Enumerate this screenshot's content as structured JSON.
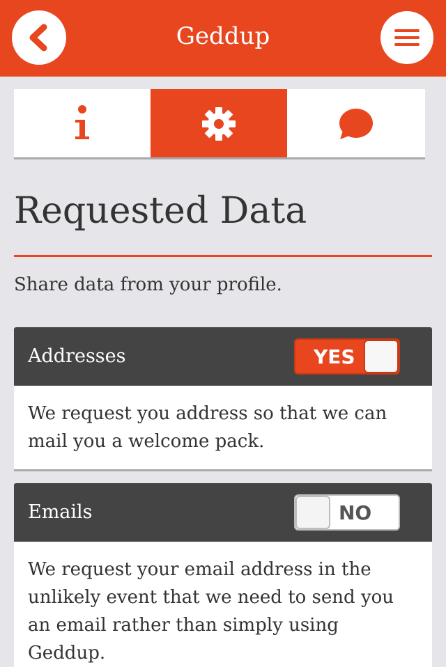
{
  "header": {
    "title": "Geddup",
    "back_icon": "chevron-left-icon",
    "menu_icon": "hamburger-menu-icon"
  },
  "tabs": [
    {
      "icon": "info-icon",
      "active": false
    },
    {
      "icon": "gear-icon",
      "active": true
    },
    {
      "icon": "chat-bubble-icon",
      "active": false
    }
  ],
  "main": {
    "title": "Requested Data",
    "intro": "Share data from your profile."
  },
  "cards": [
    {
      "label": "Addresses",
      "toggle": "YES",
      "enabled": true,
      "description": "We request you address so that we can mail you a welcome pack."
    },
    {
      "label": "Emails",
      "toggle": "NO",
      "enabled": false,
      "description": "We request your email address in the unlikely event that we need to send you an email rather than simply using Geddup."
    }
  ],
  "colors": {
    "accent": "#e8461e",
    "card_header": "#444444",
    "background": "#e6e6ea"
  }
}
